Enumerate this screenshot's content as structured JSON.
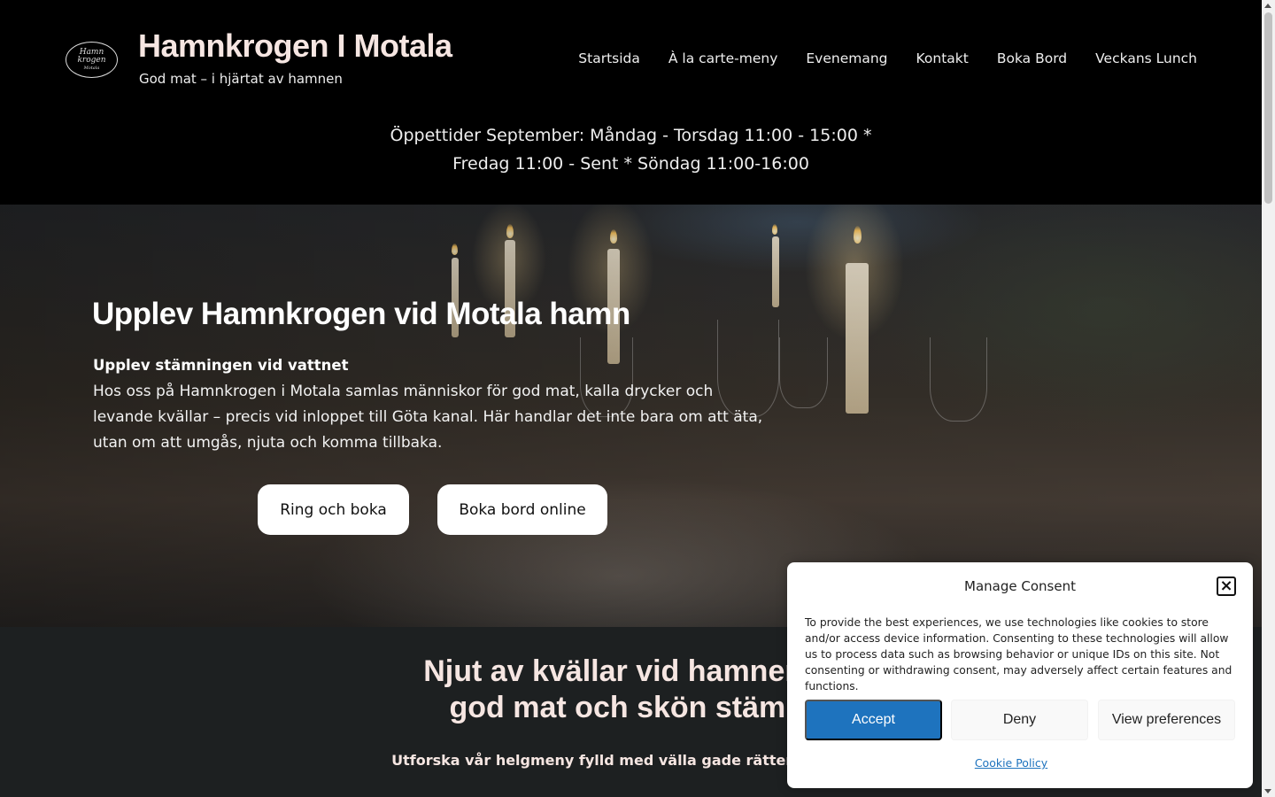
{
  "header": {
    "logo_text": [
      "Hamn",
      "krogen",
      "Motala"
    ],
    "site_title": "Hamnkrogen I Motala",
    "tagline": "God mat – i hjärtat av hamnen",
    "nav": [
      {
        "label": "Startsida"
      },
      {
        "label": "À la carte-meny"
      },
      {
        "label": "Evenemang"
      },
      {
        "label": "Kontakt"
      },
      {
        "label": "Boka Bord"
      },
      {
        "label": "Veckans Lunch"
      }
    ],
    "hours_line1": "Öppettider September: Måndag - Torsdag 11:00 - 15:00 *",
    "hours_line2": "Fredag 11:00 - Sent * Söndag 11:00-16:00"
  },
  "hero": {
    "title": "Upplev Hamnkrogen vid Motala hamn",
    "subtitle": "Upplev stämningen vid vattnet",
    "text": "Hos oss på Hamnkrogen i Motala samlas människor för god mat, kalla drycker och levande kvällar – precis vid inloppet till Göta kanal. Här handlar det inte bara om att äta, utan om att umgås, njuta och komma tillbaka.",
    "button_call": "Ring och boka",
    "button_online": "Boka bord online"
  },
  "section2": {
    "heading_line1": "Njut av kvällar vid hamnen m",
    "heading_line2": "god mat och skön stämni",
    "text": "Utforska vår helgmeny fylld med välla gade rätter och noga"
  },
  "consent": {
    "title": "Manage Consent",
    "body": "To provide the best experiences, we use technologies like cookies to store and/or access device information. Consenting to these technologies will allow us to process data such as browsing behavior or unique IDs on this site. Not consenting or withdrawing consent, may adversely affect certain features and functions.",
    "accept": "Accept",
    "deny": "Deny",
    "preferences": "View preferences",
    "policy_link": "Cookie Policy",
    "accent_color": "#1e73be"
  }
}
